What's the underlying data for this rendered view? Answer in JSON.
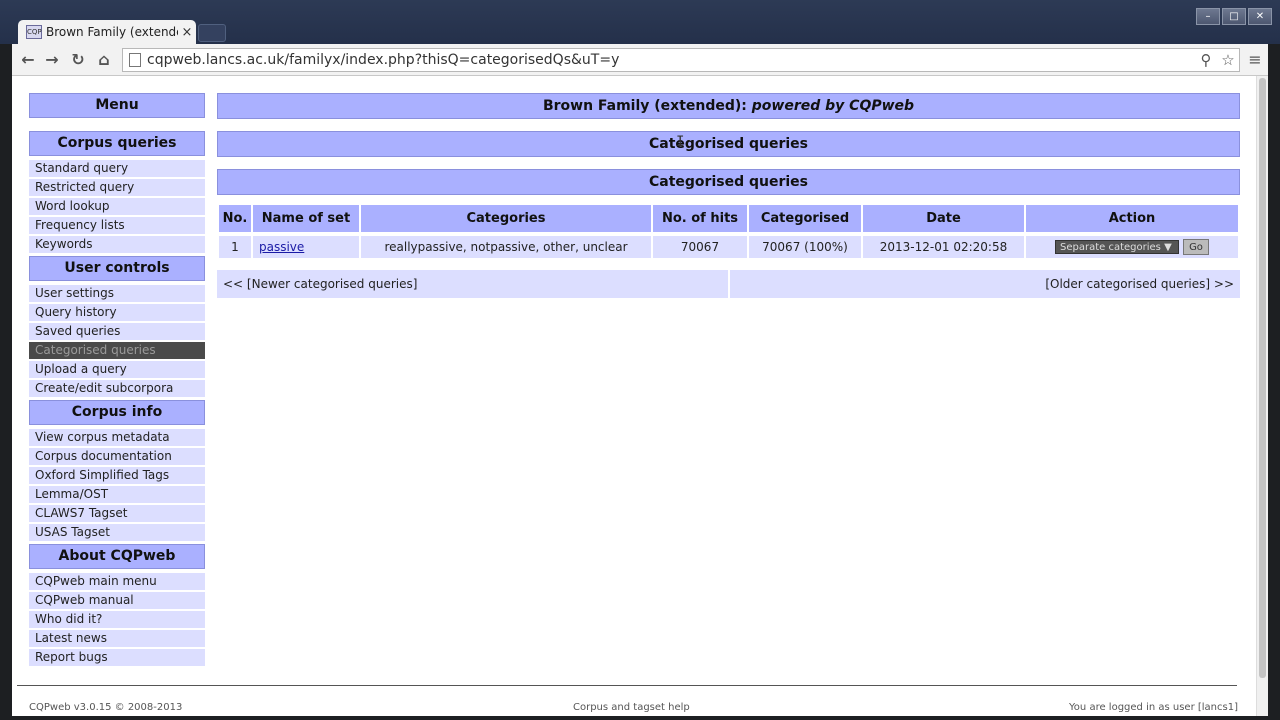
{
  "browser": {
    "tab_title": "Brown Family (extended)",
    "tab_close": "×",
    "favicon": "CQP",
    "url": "cqpweb.lancs.ac.uk/familyx/index.php?thisQ=categorisedQs&uT=y",
    "back": "←",
    "forward": "→",
    "reload": "↻",
    "home": "⌂",
    "search_icon": "⚲",
    "star_icon": "☆",
    "menu_icon": "≡",
    "minimize": "–",
    "maximize": "□",
    "close": "✕"
  },
  "sidebar": {
    "menu_header": "Menu",
    "sections": [
      {
        "header": "Corpus queries",
        "items": [
          "Standard query",
          "Restricted query",
          "Word lookup",
          "Frequency lists",
          "Keywords"
        ]
      },
      {
        "header": "User controls",
        "items": [
          "User settings",
          "Query history",
          "Saved queries",
          "Categorised queries",
          "Upload a query",
          "Create/edit subcorpora"
        ]
      },
      {
        "header": "Corpus info",
        "items": [
          "View corpus metadata",
          "Corpus documentation",
          "Oxford Simplified Tags",
          "Lemma/OST",
          "CLAWS7 Tagset",
          "USAS Tagset"
        ]
      },
      {
        "header": "About CQPweb",
        "items": [
          "CQPweb main menu",
          "CQPweb manual",
          "Who did it?",
          "Latest news",
          "Report bugs"
        ]
      }
    ],
    "selected_item": "Categorised queries"
  },
  "main": {
    "banner_title": "Brown Family (extended):",
    "banner_powered": "powered by CQPweb",
    "page_heading": "Categorised queries",
    "table_heading": "Categorised queries",
    "columns": [
      "No.",
      "Name of set",
      "Categories",
      "No. of hits",
      "Categorised",
      "Date",
      "Action"
    ],
    "rows": [
      {
        "no": "1",
        "name": "passive",
        "categories": "reallypassive, notpassive, other, unclear",
        "hits": "70067",
        "categorised": "70067 (100%)",
        "date": "2013-12-01 02:20:58",
        "action_select": "Separate categories",
        "action_select_arrow": "▼",
        "action_button": "Go"
      }
    ],
    "pager_newer": "<< [Newer categorised queries]",
    "pager_older": "[Older categorised queries] >>"
  },
  "footer": {
    "left": "CQPweb v3.0.15 © 2008-2013",
    "center": "Corpus and tagset help",
    "right": "You are logged in as user [lancs1]"
  }
}
